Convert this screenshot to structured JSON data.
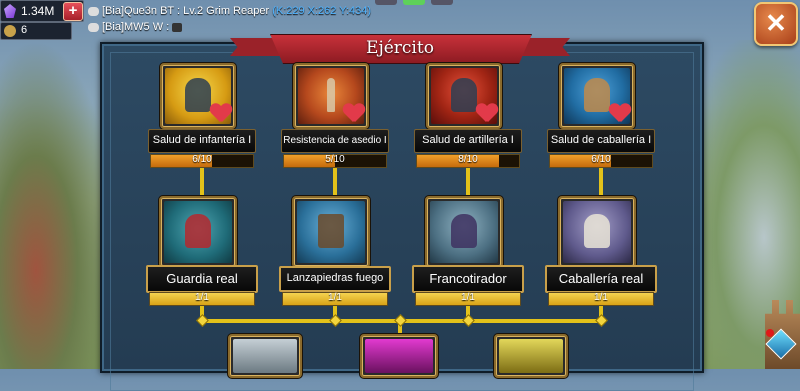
{
  "hud": {
    "gems": "1.34M",
    "level": "6"
  },
  "chat": {
    "line1_name": "[Bia]Que3n BT : Lv.2 Grim Reaper",
    "line1_coords": "(K:229 X:262 Y:434)",
    "line2": "[Bia]MW5 W :"
  },
  "panel": {
    "title": "Ejército"
  },
  "upgrades": [
    {
      "label": "Salud de infantería I",
      "progress": "6/10",
      "fraction": 0.6
    },
    {
      "label": "Resistencia de asedio I",
      "progress": "5/10",
      "fraction": 0.5
    },
    {
      "label": "Salud de artillería I",
      "progress": "8/10",
      "fraction": 0.8
    },
    {
      "label": "Salud de caballería I",
      "progress": "6/10",
      "fraction": 0.6
    }
  ],
  "units": [
    {
      "label": "Guardia real",
      "progress": "1/1",
      "fraction": 1.0
    },
    {
      "label": "Lanzapiedras fuego",
      "progress": "1/1",
      "fraction": 1.0
    },
    {
      "label": "Francotirador",
      "progress": "1/1",
      "fraction": 1.0
    },
    {
      "label": "Caballería real",
      "progress": "1/1",
      "fraction": 1.0
    }
  ],
  "colors": {
    "progress_orange": "#e38a1c",
    "progress_gold": "#f0c532",
    "connector": "#e3c21a",
    "banner_red": "#b8262f"
  },
  "icons": {
    "gem": "purple-gem-icon",
    "plus": "plus-icon",
    "close": "close-x-icon",
    "heart": "heart-plus-icon"
  }
}
